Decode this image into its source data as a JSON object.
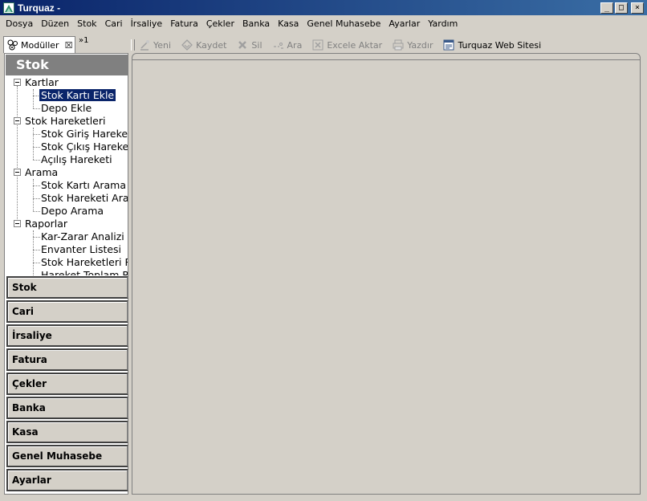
{
  "window": {
    "title": "Turquaz -",
    "minimize_label": "_",
    "maximize_label": "□",
    "close_label": "×"
  },
  "menu": [
    {
      "label": "Dosya"
    },
    {
      "label": "Düzen"
    },
    {
      "label": "Stok"
    },
    {
      "label": "Cari"
    },
    {
      "label": "İrsaliye"
    },
    {
      "label": "Fatura"
    },
    {
      "label": "Çekler"
    },
    {
      "label": "Banka"
    },
    {
      "label": "Kasa"
    },
    {
      "label": "Genel Muhasebe"
    },
    {
      "label": "Ayarlar"
    },
    {
      "label": "Yardım"
    }
  ],
  "tabs": {
    "modules_label": "Modüller",
    "close_glyph": "☒",
    "overflow_label": "»1"
  },
  "toolbar": {
    "new_label": "Yeni",
    "save_label": "Kaydet",
    "delete_label": "Sil",
    "search_label": "Ara",
    "excel_label": "Excele Aktar",
    "print_label": "Yazdır",
    "website_label": "Turquaz Web Sitesi"
  },
  "module_panel": {
    "title": "Stok",
    "tree": {
      "kartlar": {
        "label": "Kartlar",
        "children": [
          "Stok Kartı Ekle",
          "Depo Ekle"
        ]
      },
      "hareketler": {
        "label": "Stok Hareketleri",
        "children": [
          "Stok Giriş Hareketi",
          "Stok Çıkış Hareketi",
          "Açılış Hareketi"
        ]
      },
      "arama": {
        "label": "Arama",
        "children": [
          "Stok Kartı Arama",
          "Stok Hareketi Arama",
          "Depo Arama"
        ]
      },
      "raporlar": {
        "label": "Raporlar",
        "children": [
          "Kar-Zarar Analizi",
          "Envanter Listesi",
          "Stok Hareketleri Raporu",
          "Hareket Toplam Raporu"
        ]
      }
    },
    "selected_item": "Stok Kartı Ekle"
  },
  "modules": [
    {
      "label": "Stok"
    },
    {
      "label": "Cari"
    },
    {
      "label": "İrsaliye"
    },
    {
      "label": "Fatura"
    },
    {
      "label": "Çekler"
    },
    {
      "label": "Banka"
    },
    {
      "label": "Kasa"
    },
    {
      "label": "Genel Muhasebe"
    },
    {
      "label": "Ayarlar"
    }
  ],
  "colors": {
    "titlebar": "#0a246a",
    "selection": "#0a246a",
    "face": "#d4d0c8"
  }
}
